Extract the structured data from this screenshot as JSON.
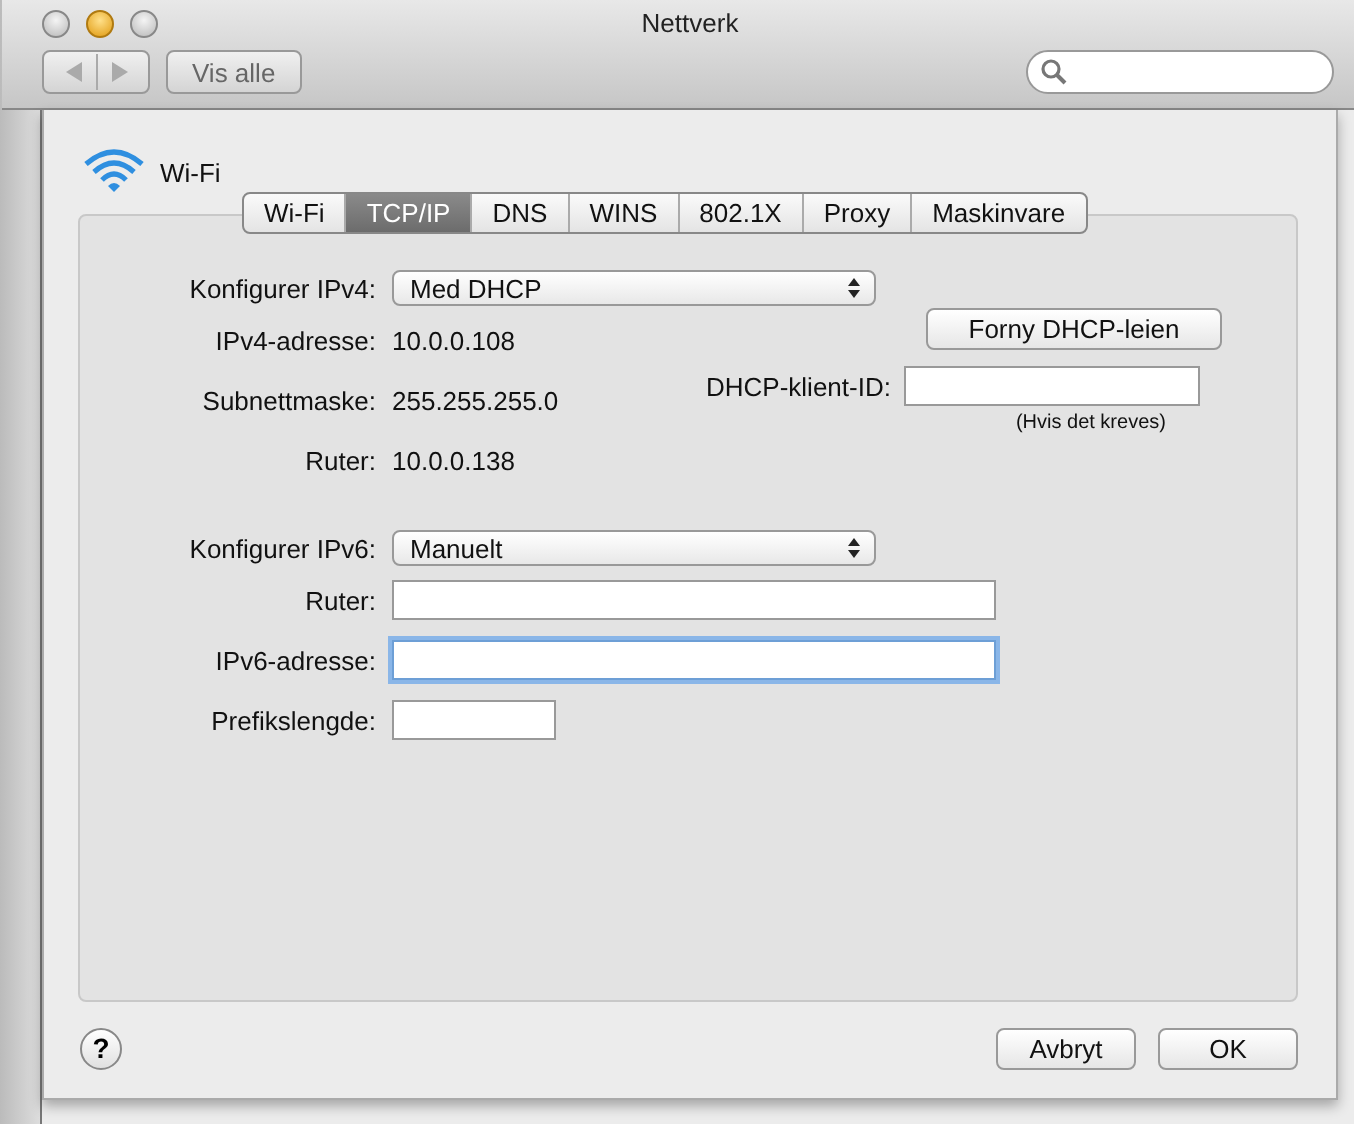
{
  "window": {
    "title": "Nettverk"
  },
  "toolbar": {
    "show_all": "Vis alle"
  },
  "interface": {
    "name": "Wi-Fi"
  },
  "tabs": [
    {
      "label": "Wi-Fi",
      "selected": false
    },
    {
      "label": "TCP/IP",
      "selected": true
    },
    {
      "label": "DNS",
      "selected": false
    },
    {
      "label": "WINS",
      "selected": false
    },
    {
      "label": "802.1X",
      "selected": false
    },
    {
      "label": "Proxy",
      "selected": false
    },
    {
      "label": "Maskinvare",
      "selected": false
    }
  ],
  "ipv4": {
    "label": "Konfigurer IPv4:",
    "value": "Med DHCP"
  },
  "ipv4_info": [
    {
      "label": "IPv4-adresse:",
      "value": "10.0.0.108"
    },
    {
      "label": "Subnettmaske:",
      "value": "255.255.255.0"
    },
    {
      "label": "Ruter:",
      "value": "10.0.0.138"
    }
  ],
  "renew_button": "Forny DHCP-leien",
  "client_id": {
    "label": "DHCP-klient-ID:",
    "hint": "(Hvis det kreves)"
  },
  "ipv6": {
    "label": "Konfigurer IPv6:",
    "value": "Manuelt"
  },
  "ipv6_fields": [
    {
      "label": "Ruter:",
      "kind": "address",
      "focused": false
    },
    {
      "label": "IPv6-adresse:",
      "kind": "address",
      "focused": true
    },
    {
      "label": "Prefikslengde:",
      "kind": "prefix",
      "focused": false
    }
  ],
  "help": "?",
  "buttons": [
    "Avbryt",
    "OK"
  ]
}
